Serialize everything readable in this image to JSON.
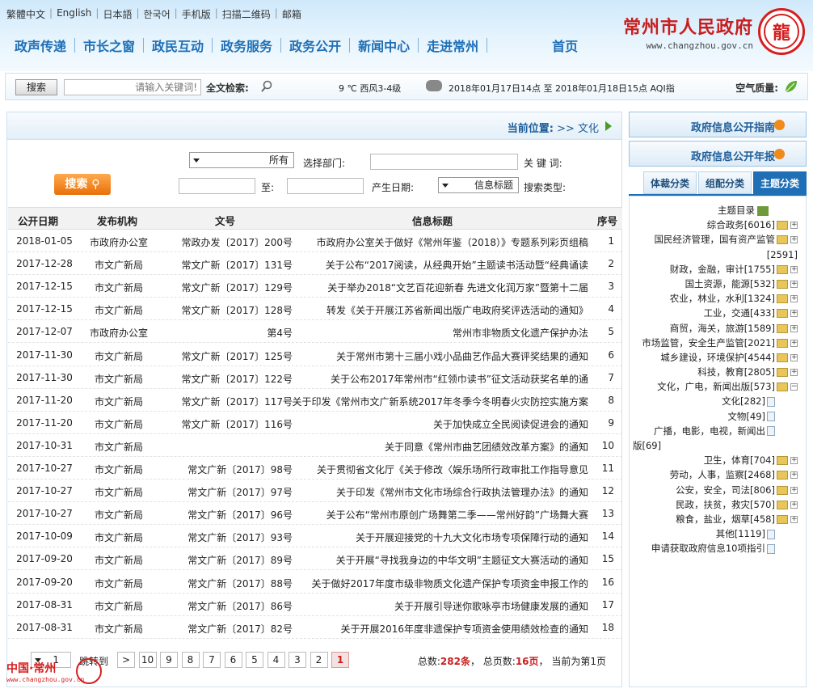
{
  "toplinks": [
    "繁體中文",
    "English",
    "日本語",
    "한국어",
    "手机版",
    "扫描二维码",
    "邮箱"
  ],
  "logo": {
    "title": "常州市人民政府",
    "url": "www.changzhou.gov.cn"
  },
  "nav": [
    "首页",
    "走进常州",
    "新闻中心",
    "政务公开",
    "政务服务",
    "政民互动",
    "市长之窗",
    "政声传递"
  ],
  "strip": {
    "search_button": "搜索",
    "keyword_placeholder": "请输入关键词!",
    "fulltext_label": "全文检索:",
    "weather": "2018年01月17日14点 至 2018年01月18日15点 AQI指",
    "weather_temp": "9 ℃ 西风3-4级",
    "air_label": "空气质量:"
  },
  "side": {
    "guide": "政府信息公开指南",
    "annual": "政府信息公开年报",
    "tabs": [
      "主题分类",
      "组配分类",
      "体裁分类"
    ],
    "tree": [
      {
        "label": "主题目录",
        "kind": "root"
      },
      {
        "label": "综合政务[6016]",
        "kind": "folder"
      },
      {
        "label": "国民经济管理，国有资产监管",
        "kind": "folder"
      },
      {
        "label": "[2591]",
        "kind": "cont"
      },
      {
        "label": "财政，金融，审计[1755]",
        "kind": "folder"
      },
      {
        "label": "国土资源，能源[532]",
        "kind": "folder"
      },
      {
        "label": "农业，林业，水利[1324]",
        "kind": "folder"
      },
      {
        "label": "工业，交通[433]",
        "kind": "folder"
      },
      {
        "label": "商贸，海关，旅游[1589]",
        "kind": "folder"
      },
      {
        "label": "市场监管，安全生产监管[2021]",
        "kind": "folder"
      },
      {
        "label": "城乡建设，环境保护[4544]",
        "kind": "folder"
      },
      {
        "label": "科技，教育[2805]",
        "kind": "folder"
      },
      {
        "label": "文化，广电，新闻出版[573]",
        "kind": "folder-open"
      },
      {
        "label": "文化[282]",
        "kind": "page"
      },
      {
        "label": "文物[49]",
        "kind": "page"
      },
      {
        "label": "广播，电影，电视，新闻出",
        "kind": "page"
      },
      {
        "label": "版[69]",
        "kind": "cont2"
      },
      {
        "label": "卫生，体育[704]",
        "kind": "folder"
      },
      {
        "label": "劳动，人事，监察[2468]",
        "kind": "folder"
      },
      {
        "label": "公安，安全，司法[806]",
        "kind": "folder"
      },
      {
        "label": "民政，扶贫，救灾[570]",
        "kind": "folder"
      },
      {
        "label": "粮食，盐业，烟草[458]",
        "kind": "folder"
      },
      {
        "label": "其他[1119]",
        "kind": "page"
      },
      {
        "label": "申请获取政府信息10项指引",
        "kind": "page"
      }
    ]
  },
  "breadcrumb": {
    "label": "当前位置:",
    "path": ">> 文化"
  },
  "form": {
    "keyword_label": "关 键 词:",
    "dept_label": "选择部门:",
    "dept_value": "所有",
    "type_label": "搜索类型:",
    "type_value": "信息标题",
    "date_label": "产生日期:",
    "to_label": "至:",
    "search_button": "搜索"
  },
  "table": {
    "headers": [
      "序号",
      "信息标题",
      "文号",
      "发布机构",
      "公开日期"
    ],
    "rows": [
      [
        "1",
        "市政府办公室关于做好《常州年鉴（2018）》专题系列彩页组稿",
        "常政办发〔2017〕200号",
        "市政府办公室",
        "2018-01-05"
      ],
      [
        "2",
        "关于公布“2017阅读，从经典开始”主题读书活动暨“经典诵读",
        "常文广新〔2017〕131号",
        "市文广新局",
        "2017-12-28"
      ],
      [
        "3",
        "关于举办2018“文艺百花迎新春 先进文化润万家”暨第十二届",
        "常文广新〔2017〕129号",
        "市文广新局",
        "2017-12-15"
      ],
      [
        "4",
        "转发《关于开展江苏省新闻出版广电政府奖评选活动的通知》",
        "常文广新〔2017〕128号",
        "市文广新局",
        "2017-12-15"
      ],
      [
        "5",
        "常州市非物质文化遗产保护办法",
        "第4号",
        "市政府办公室",
        "2017-12-07"
      ],
      [
        "6",
        "关于常州市第十三届小戏小品曲艺作品大赛评奖结果的通知",
        "常文广新〔2017〕125号",
        "市文广新局",
        "2017-11-30"
      ],
      [
        "7",
        "关于公布2017年常州市“红领巾读书”征文活动获奖名单的通",
        "常文广新〔2017〕122号",
        "市文广新局",
        "2017-11-30"
      ],
      [
        "8",
        "关于印发《常州市文广新系统2017年冬季今冬明春火灾防控实施方案",
        "常文广新〔2017〕117号",
        "市文广新局",
        "2017-11-20"
      ],
      [
        "9",
        "关于加快成立全民阅读促进会的通知",
        "常文广新〔2017〕116号",
        "市文广新局",
        "2017-11-20"
      ],
      [
        "10",
        "关于同意《常州市曲艺团绩效改革方案》的通知",
        "",
        "市文广新局",
        "2017-10-31"
      ],
      [
        "11",
        "关于贯彻省文化厅《关于修改〈娱乐场所行政审批工作指导意见",
        "常文广新〔2017〕98号",
        "市文广新局",
        "2017-10-27"
      ],
      [
        "12",
        "关于印发《常州市文化市场综合行政执法管理办法》的通知",
        "常文广新〔2017〕97号",
        "市文广新局",
        "2017-10-27"
      ],
      [
        "13",
        "关于公布“常州市原创广场舞第二季——常州好韵”广场舞大赛",
        "常文广新〔2017〕96号",
        "市文广新局",
        "2017-10-27"
      ],
      [
        "14",
        "关于开展迎接党的十九大文化市场专项保障行动的通知",
        "常文广新〔2017〕93号",
        "市文广新局",
        "2017-10-09"
      ],
      [
        "15",
        "关于开展“寻找我身边的中华文明”主题征文大赛活动的通知",
        "常文广新〔2017〕89号",
        "市文广新局",
        "2017-09-20"
      ],
      [
        "16",
        "关于做好2017年度市级非物质文化遗产保护专项资金申报工作的",
        "常文广新〔2017〕88号",
        "市文广新局",
        "2017-09-20"
      ],
      [
        "17",
        "关于开展引导迷你歌咏亭市场健康发展的通知",
        "常文广新〔2017〕86号",
        "市文广新局",
        "2017-08-31"
      ],
      [
        "18",
        "关于开展2016年度非遗保护专项资金使用绩效检查的通知",
        "常文广新〔2017〕82号",
        "市文广新局",
        "2017-08-31"
      ]
    ]
  },
  "pager": {
    "pages": [
      "1",
      "2",
      "3",
      "4",
      "5",
      "6",
      "7",
      "8",
      "9",
      "10",
      ">"
    ],
    "active": "1",
    "jump_label": "跳转到",
    "jump_page": "1",
    "total_label": "总数:",
    "total": "282条",
    "pages_label": "总页数:",
    "page_count": "16页",
    "current_label": "当前为第1页"
  },
  "footer": {
    "logo_text": "中国·常州",
    "logo_url": "www.changzhou.gov.cn"
  }
}
